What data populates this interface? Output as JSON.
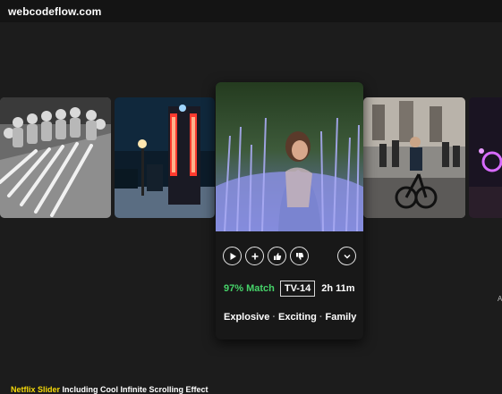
{
  "header": {
    "site": "webcodeflow.com"
  },
  "featured": {
    "match": "97% Match",
    "rating": "TV-14",
    "duration": "2h 11m",
    "genres": [
      "Explosive",
      "Exciting",
      "Family"
    ],
    "separator": "·",
    "controls": [
      "play-icon",
      "plus-icon",
      "thumbs-up-icon",
      "thumbs-down-icon",
      "chevron-down-icon"
    ]
  },
  "edge_text": "A",
  "caption": {
    "highlight": "Netflix Slider",
    "rest": " Including Cool Infinite Scrolling Effect"
  },
  "colors": {
    "background": "#1c1c1c",
    "match": "#46d369",
    "caption_highlight": "#f5d90a"
  }
}
